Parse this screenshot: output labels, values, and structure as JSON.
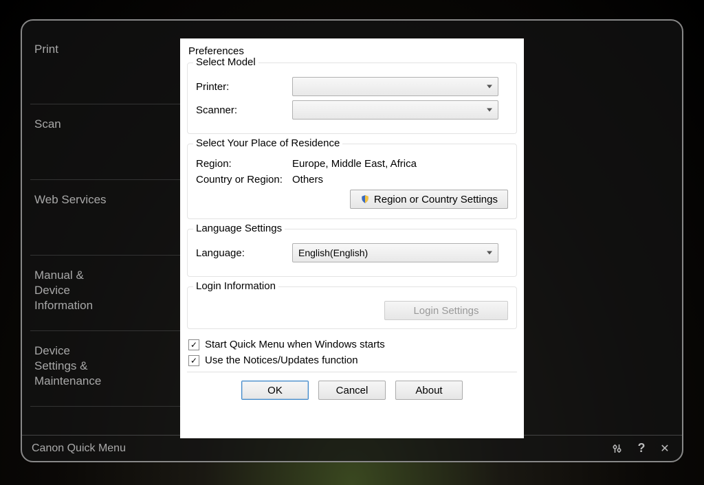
{
  "footer": {
    "app_name": "Canon Quick Menu"
  },
  "sidebar": {
    "items": [
      {
        "label": "Print"
      },
      {
        "label": "Scan"
      },
      {
        "label": "Web Services"
      },
      {
        "label": "Manual & Device Information"
      },
      {
        "label": "Device Settings & Maintenance"
      }
    ]
  },
  "dialog": {
    "title": "Preferences",
    "select_model": {
      "legend": "Select Model",
      "printer_label": "Printer:",
      "printer_value": "",
      "scanner_label": "Scanner:",
      "scanner_value": ""
    },
    "residence": {
      "legend": "Select Your Place of Residence",
      "region_label": "Region:",
      "region_value": "Europe, Middle East, Africa",
      "country_label": "Country or Region:",
      "country_value": "Others",
      "button": "Region or Country Settings"
    },
    "language": {
      "legend": "Language Settings",
      "label": "Language:",
      "value": "English(English)"
    },
    "login": {
      "legend": "Login Information",
      "button": "Login Settings"
    },
    "start_with_windows": "Start Quick Menu when Windows starts",
    "use_notices": "Use the Notices/Updates function",
    "buttons": {
      "ok": "OK",
      "cancel": "Cancel",
      "about": "About"
    }
  }
}
